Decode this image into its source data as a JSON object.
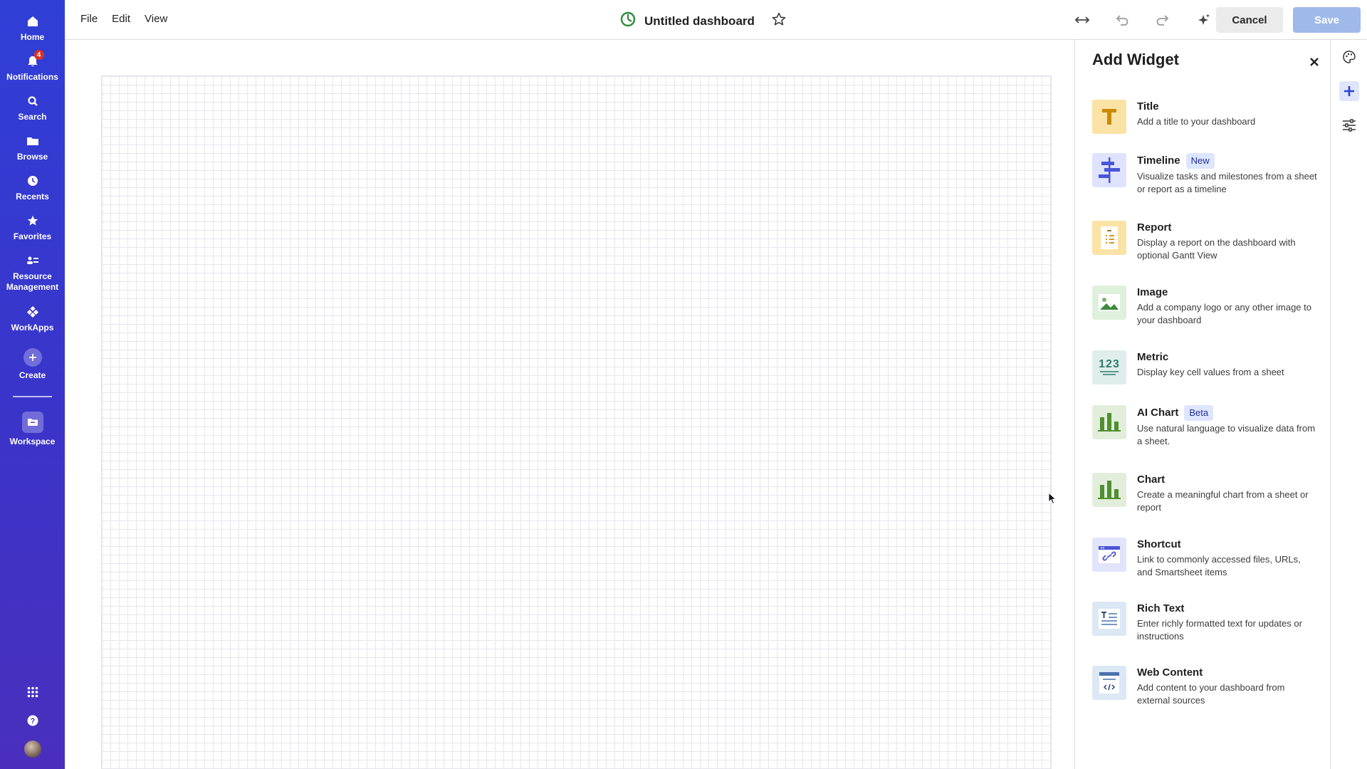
{
  "nav": {
    "items": [
      {
        "label": "Home",
        "icon": "home-icon"
      },
      {
        "label": "Notifications",
        "icon": "bell-icon",
        "badge": "4"
      },
      {
        "label": "Search",
        "icon": "search-icon"
      },
      {
        "label": "Browse",
        "icon": "folder-icon"
      },
      {
        "label": "Recents",
        "icon": "clock-icon"
      },
      {
        "label": "Favorites",
        "icon": "star-icon"
      },
      {
        "label": "Resource Management",
        "icon": "people-icon"
      },
      {
        "label": "WorkApps",
        "icon": "workapps-icon"
      },
      {
        "label": "Create",
        "icon": "plus-circle-icon"
      },
      {
        "label": "Workspace",
        "icon": "workspace-icon"
      }
    ],
    "colors": {
      "rail_top": "#2f3fd6",
      "rail_bottom": "#4a2fbd"
    }
  },
  "menu": {
    "file": "File",
    "edit": "Edit",
    "view": "View"
  },
  "header": {
    "title": "Untitled dashboard",
    "cancel_label": "Cancel",
    "save_label": "Save"
  },
  "panel": {
    "title": "Add Widget",
    "widgets": [
      {
        "name": "Title",
        "tag": "",
        "description": "Add a title to your dashboard",
        "icon": "title-widget-icon"
      },
      {
        "name": "Timeline",
        "tag": "New",
        "description": "Visualize tasks and milestones from a sheet or report as a timeline",
        "icon": "timeline-widget-icon"
      },
      {
        "name": "Report",
        "tag": "",
        "description": "Display a report on the dashboard with optional Gantt View",
        "icon": "report-widget-icon"
      },
      {
        "name": "Image",
        "tag": "",
        "description": "Add a company logo or any other image to your dashboard",
        "icon": "image-widget-icon"
      },
      {
        "name": "Metric",
        "tag": "",
        "description": "Display key cell values from a sheet",
        "icon": "metric-widget-icon"
      },
      {
        "name": "AI Chart",
        "tag": "Beta",
        "description": "Use natural language to visualize data from a sheet.",
        "icon": "ai-chart-widget-icon"
      },
      {
        "name": "Chart",
        "tag": "",
        "description": "Create a meaningful chart from a sheet or report",
        "icon": "chart-widget-icon"
      },
      {
        "name": "Shortcut",
        "tag": "",
        "description": "Link to commonly accessed files, URLs, and Smartsheet items",
        "icon": "shortcut-widget-icon"
      },
      {
        "name": "Rich Text",
        "tag": "",
        "description": "Enter richly formatted text for updates or instructions",
        "icon": "rich-text-widget-icon"
      },
      {
        "name": "Web Content",
        "tag": "",
        "description": "Add content to your dashboard from external sources",
        "icon": "web-content-widget-icon"
      }
    ],
    "metric_glyph": "123"
  },
  "colors": {
    "accent": "#2f3fd6",
    "save_disabled": "#9fb9ea",
    "tag_bg": "#dde5ff"
  }
}
